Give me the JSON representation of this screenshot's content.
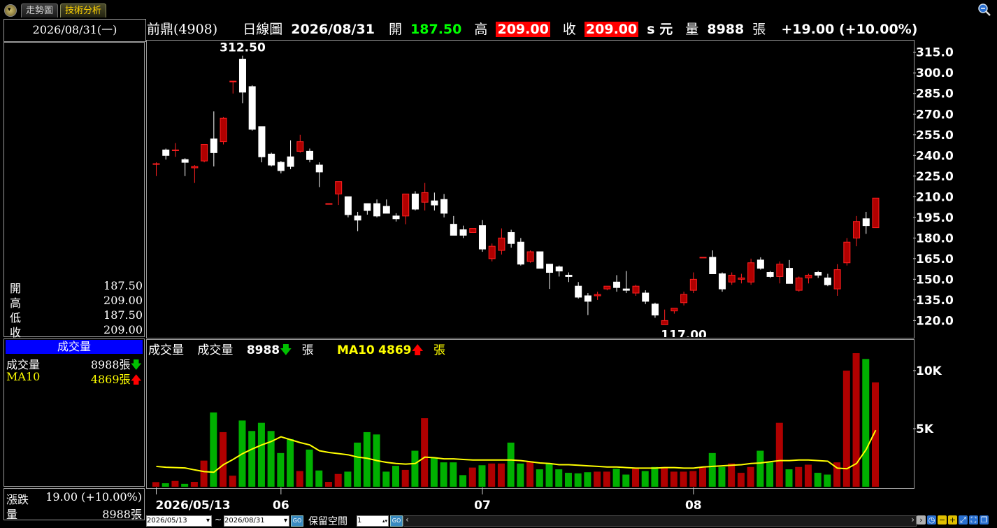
{
  "tabs": {
    "trend": "走勢圖",
    "tech": "技術分析"
  },
  "left": {
    "date": "2026/08/31(一)",
    "ohlc": [
      {
        "label": "開",
        "value": "187.50"
      },
      {
        "label": "高",
        "value": "209.00"
      },
      {
        "label": "低",
        "value": "187.50"
      },
      {
        "label": "收",
        "value": "209.00"
      }
    ],
    "vol_title": "成交量",
    "vol_label": "成交量",
    "vol_value": "8988張",
    "vol_arrow": "🡇",
    "ma_label": "MA10",
    "ma_value": "4869張",
    "ma_arrow": "🡅",
    "chg_label": "漲跌",
    "chg_value": "19.00 (+10.00%)",
    "qty_label": "量",
    "qty_value": "8988張"
  },
  "header": {
    "stock": "前鼎(4908)",
    "period": "日線圖",
    "date": "2026/08/31",
    "open_label": "開",
    "open": "187.50",
    "high_label": "高",
    "high": "209.00",
    "close_label": "收",
    "close": "209.00",
    "unit": "s 元",
    "vol_label": "量",
    "vol": "8988",
    "vol_unit": "張",
    "change": "+19.00 (+10.00%)"
  },
  "vol_header": {
    "title": "成交量",
    "vol_label": "成交量",
    "vol": "8988",
    "vol_unit": "張",
    "ma_label": "MA10",
    "ma": "4869",
    "ma_unit": "張",
    "arrow_down": "🡇",
    "arrow_up": "🡅"
  },
  "bottom": {
    "start_date": "2026/05/13",
    "end_date": "2026/08/31",
    "sep": "~",
    "keep_label": "保留空間",
    "keep_value": "1",
    "go_label": "GO"
  },
  "colors": {
    "up": "#b00000",
    "down": "#ffffff",
    "vol_up": "#b00000",
    "vol_down": "#00b000",
    "ma": "#ffff00"
  },
  "chart_data": {
    "type": "candlestick",
    "x_ticks": [
      {
        "label": "2026/05/13",
        "index": 0
      },
      {
        "label": "06",
        "index": 13
      },
      {
        "label": "07",
        "index": 34
      },
      {
        "label": "08",
        "index": 56
      }
    ],
    "y_price_ticks": [
      "315.0",
      "300.0",
      "285.0",
      "270.0",
      "255.0",
      "240.0",
      "225.0",
      "210.0",
      "195.0",
      "180.0",
      "165.0",
      "150.0",
      "135.0",
      "120.0"
    ],
    "y_price_range": [
      108,
      324
    ],
    "y_volume_ticks": [
      {
        "label": "10K",
        "value": 10000
      },
      {
        "label": "5K",
        "value": 5000
      }
    ],
    "y_volume_range": [
      0,
      11500
    ],
    "annotations": [
      {
        "text": "312.50",
        "index": 9,
        "value": 312.5,
        "pos": "above"
      },
      {
        "text": "117.00",
        "index": 55,
        "value": 117.0,
        "pos": "below"
      }
    ],
    "candles": [
      {
        "o": 234,
        "h": 235,
        "l": 225,
        "c": 234
      },
      {
        "o": 244,
        "h": 245,
        "l": 237,
        "c": 240
      },
      {
        "o": 244,
        "h": 249,
        "l": 239,
        "c": 244
      },
      {
        "o": 237,
        "h": 238,
        "l": 225,
        "c": 235
      },
      {
        "o": 231,
        "h": 233,
        "l": 220,
        "c": 232
      },
      {
        "o": 236,
        "h": 248,
        "l": 235,
        "c": 248
      },
      {
        "o": 252,
        "h": 272,
        "l": 232,
        "c": 242
      },
      {
        "o": 250,
        "h": 268,
        "l": 248,
        "c": 267
      },
      {
        "o": 294,
        "h": 294,
        "l": 285,
        "c": 294
      },
      {
        "o": 310,
        "h": 312.5,
        "l": 278,
        "c": 286
      },
      {
        "o": 290,
        "h": 291,
        "l": 258,
        "c": 259
      },
      {
        "o": 261,
        "h": 261,
        "l": 235,
        "c": 239
      },
      {
        "o": 241,
        "h": 242,
        "l": 232,
        "c": 233
      },
      {
        "o": 235,
        "h": 236,
        "l": 227,
        "c": 229
      },
      {
        "o": 239,
        "h": 251,
        "l": 230,
        "c": 232
      },
      {
        "o": 243,
        "h": 255,
        "l": 242,
        "c": 250
      },
      {
        "o": 243,
        "h": 245,
        "l": 235,
        "c": 237
      },
      {
        "o": 233,
        "h": 235,
        "l": 217,
        "c": 228
      },
      {
        "o": 205,
        "h": 205,
        "l": 205,
        "c": 205
      },
      {
        "o": 212,
        "h": 221,
        "l": 204,
        "c": 221
      },
      {
        "o": 210,
        "h": 210,
        "l": 195,
        "c": 197
      },
      {
        "o": 196,
        "h": 199,
        "l": 185,
        "c": 193
      },
      {
        "o": 205,
        "h": 205,
        "l": 197,
        "c": 200
      },
      {
        "o": 205,
        "h": 208,
        "l": 195,
        "c": 196
      },
      {
        "o": 203,
        "h": 208,
        "l": 199,
        "c": 198
      },
      {
        "o": 196,
        "h": 198,
        "l": 192,
        "c": 194
      },
      {
        "o": 196,
        "h": 212,
        "l": 190,
        "c": 212
      },
      {
        "o": 212,
        "h": 214,
        "l": 200,
        "c": 201
      },
      {
        "o": 206,
        "h": 220,
        "l": 200,
        "c": 213
      },
      {
        "o": 207,
        "h": 213,
        "l": 200,
        "c": 204
      },
      {
        "o": 208,
        "h": 212,
        "l": 195,
        "c": 198
      },
      {
        "o": 190,
        "h": 196,
        "l": 183,
        "c": 182
      },
      {
        "o": 186,
        "h": 189,
        "l": 180,
        "c": 182
      },
      {
        "o": 184,
        "h": 186,
        "l": 184,
        "c": 187
      },
      {
        "o": 189,
        "h": 193,
        "l": 170,
        "c": 172
      },
      {
        "o": 165,
        "h": 176,
        "l": 163,
        "c": 174
      },
      {
        "o": 171,
        "h": 187,
        "l": 168,
        "c": 180
      },
      {
        "o": 184,
        "h": 186,
        "l": 173,
        "c": 176
      },
      {
        "o": 177,
        "h": 180,
        "l": 160,
        "c": 161
      },
      {
        "o": 163,
        "h": 171,
        "l": 162,
        "c": 170
      },
      {
        "o": 170,
        "h": 170,
        "l": 161,
        "c": 158
      },
      {
        "o": 161,
        "h": 161,
        "l": 143,
        "c": 155
      },
      {
        "o": 159,
        "h": 160,
        "l": 152,
        "c": 156
      },
      {
        "o": 153,
        "h": 155,
        "l": 148,
        "c": 152
      },
      {
        "o": 145,
        "h": 148,
        "l": 136,
        "c": 137
      },
      {
        "o": 138,
        "h": 140,
        "l": 124,
        "c": 134
      },
      {
        "o": 138,
        "h": 141,
        "l": 135,
        "c": 139
      },
      {
        "o": 143,
        "h": 145,
        "l": 142,
        "c": 145
      },
      {
        "o": 148,
        "h": 153,
        "l": 141,
        "c": 144
      },
      {
        "o": 143,
        "h": 156,
        "l": 140,
        "c": 142
      },
      {
        "o": 140,
        "h": 146,
        "l": 138,
        "c": 145
      },
      {
        "o": 140,
        "h": 142,
        "l": 132,
        "c": 134
      },
      {
        "o": 132,
        "h": 133,
        "l": 122,
        "c": 124
      },
      {
        "o": 117,
        "h": 128,
        "l": 117,
        "c": 120
      },
      {
        "o": 127,
        "h": 128,
        "l": 125,
        "c": 129
      },
      {
        "o": 133,
        "h": 141,
        "l": 131,
        "c": 139
      },
      {
        "o": 142,
        "h": 155,
        "l": 140,
        "c": 150
      },
      {
        "o": 166,
        "h": 166,
        "l": 166,
        "c": 166
      },
      {
        "o": 166,
        "h": 171,
        "l": 157,
        "c": 154
      },
      {
        "o": 154,
        "h": 155,
        "l": 141,
        "c": 143
      },
      {
        "o": 148,
        "h": 155,
        "l": 146,
        "c": 153
      },
      {
        "o": 150,
        "h": 154,
        "l": 147,
        "c": 151
      },
      {
        "o": 148,
        "h": 165,
        "l": 146,
        "c": 162
      },
      {
        "o": 164,
        "h": 166,
        "l": 157,
        "c": 158
      },
      {
        "o": 155,
        "h": 156,
        "l": 151,
        "c": 152
      },
      {
        "o": 152,
        "h": 163,
        "l": 147,
        "c": 161
      },
      {
        "o": 158,
        "h": 164,
        "l": 147,
        "c": 147
      },
      {
        "o": 142,
        "h": 152,
        "l": 141,
        "c": 151
      },
      {
        "o": 151,
        "h": 154,
        "l": 147,
        "c": 153
      },
      {
        "o": 155,
        "h": 156,
        "l": 151,
        "c": 153
      },
      {
        "o": 151,
        "h": 154,
        "l": 145,
        "c": 146
      },
      {
        "o": 143,
        "h": 161,
        "l": 138,
        "c": 157
      },
      {
        "o": 162,
        "h": 180,
        "l": 160,
        "c": 177
      },
      {
        "o": 180,
        "h": 196,
        "l": 174,
        "c": 192
      },
      {
        "o": 194,
        "h": 199,
        "l": 183,
        "c": 189
      },
      {
        "o": 187.5,
        "h": 209,
        "l": 187.5,
        "c": 209
      }
    ],
    "volume": [
      400,
      300,
      500,
      250,
      420,
      2250,
      6400,
      4700,
      950,
      5700,
      4800,
      5500,
      4800,
      2900,
      4100,
      1350,
      3200,
      1400,
      420,
      1100,
      1300,
      3800,
      4700,
      4500,
      1300,
      1800,
      1450,
      3100,
      5900,
      2500,
      2100,
      2100,
      1000,
      1650,
      1850,
      2000,
      2000,
      3800,
      2000,
      2200,
      1500,
      2000,
      1500,
      1200,
      1150,
      1250,
      1300,
      1300,
      1550,
      1050,
      1550,
      1350,
      1700,
      1700,
      1300,
      1300,
      1350,
      1650,
      2900,
      1700,
      2000,
      1200,
      1700,
      3100,
      2100,
      5500,
      1500,
      1700,
      1900,
      1200,
      1050,
      2100,
      10000,
      11500,
      11000,
      8988
    ],
    "ma10": [
      1750,
      1680,
      1650,
      1620,
      1450,
      1300,
      1250,
      1900,
      2350,
      2850,
      3250,
      3600,
      3900,
      4300,
      4050,
      3800,
      3600,
      3100,
      2950,
      2850,
      2750,
      2550,
      2450,
      2250,
      2100,
      2000,
      1950,
      2000,
      2550,
      2500,
      2400,
      2400,
      2350,
      2300,
      2300,
      2300,
      2300,
      2300,
      2250,
      2150,
      2050,
      2000,
      1900,
      1900,
      1850,
      1800,
      1750,
      1700,
      1700,
      1650,
      1600,
      1600,
      1600,
      1650,
      1650,
      1600,
      1600,
      1700,
      1750,
      1800,
      1850,
      1900,
      2000,
      2050,
      2150,
      2250,
      2250,
      2300,
      2300,
      2250,
      2200,
      1600,
      1550,
      2000,
      3200,
      4869
    ]
  }
}
